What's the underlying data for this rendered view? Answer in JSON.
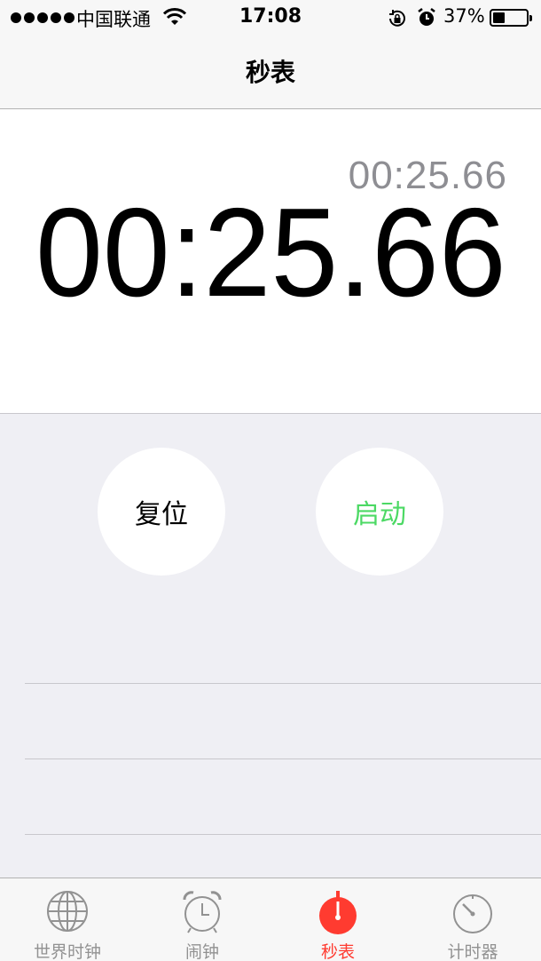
{
  "status_bar": {
    "carrier": "中国联通",
    "time": "17:08",
    "battery_percent": "37%",
    "battery_level": 0.37
  },
  "nav": {
    "title": "秒表"
  },
  "stopwatch": {
    "lap_time": "00:25.66",
    "main_time": "00:25.66"
  },
  "controls": {
    "reset_label": "复位",
    "start_label": "启动",
    "start_color": "#4cd964"
  },
  "tab_bar": {
    "tabs": [
      {
        "label": "世界时钟",
        "icon": "globe-icon"
      },
      {
        "label": "闹钟",
        "icon": "alarm-clock-icon"
      },
      {
        "label": "秒表",
        "icon": "stopwatch-icon",
        "active": true
      },
      {
        "label": "计时器",
        "icon": "timer-icon"
      }
    ],
    "active_color": "#ff3b30"
  }
}
